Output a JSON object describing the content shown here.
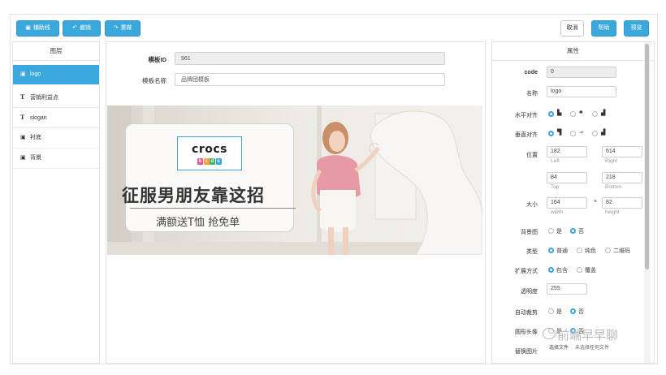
{
  "toolbar": {
    "guides_label": "辅助线",
    "undo_label": "撤销",
    "redo_label": "重做",
    "cancel_label": "取消",
    "help_label": "帮助",
    "preview_label": "预览"
  },
  "layers": {
    "header": "图层",
    "items": [
      {
        "icon": "image-icon",
        "label": "logo",
        "active": true
      },
      {
        "icon": "text-icon",
        "label": "营销利益点"
      },
      {
        "icon": "text-icon",
        "label": "slogan"
      },
      {
        "icon": "image-icon",
        "label": "衬底"
      },
      {
        "icon": "image-icon",
        "label": "背景"
      }
    ]
  },
  "template": {
    "id_label": "模板ID",
    "id_value": "961",
    "name_label": "模板名称",
    "name_value": "品牌团模板"
  },
  "banner": {
    "logo_text": "crocs",
    "logo_sub": [
      "k",
      "i",
      "d",
      "s"
    ],
    "slogan": "征服男朋友靠这招",
    "benefit": "满额送T恤 抢免单"
  },
  "properties": {
    "header": "属性",
    "code_label": "code",
    "code_value": "0",
    "name_label": "名称",
    "name_value": "logo",
    "halign_label": "水平对齐",
    "valign_label": "垂直对齐",
    "position_label": "位置",
    "left_value": "182",
    "left_hint": "Left",
    "right_value": "614",
    "right_hint": "Right",
    "top_value": "84",
    "top_hint": "Top",
    "bottom_value": "218",
    "bottom_hint": "Bottom",
    "size_label": "大小",
    "width_value": "164",
    "width_hint": "width",
    "times": "×",
    "height_value": "82",
    "height_hint": "height",
    "bgimage_label": "背景图",
    "yes": "是",
    "no": "否",
    "type_label": "类型",
    "type_normal": "普通",
    "type_solid": "纯色",
    "type_qr": "二维码",
    "expand_label": "扩展方式",
    "expand_contain": "包含",
    "expand_cover": "覆盖",
    "opacity_label": "透明度",
    "opacity_value": "255",
    "autocrop_label": "自动裁剪",
    "round_label": "圆形头像",
    "replace_label": "替换图片",
    "choose_file": "选择文件",
    "no_file": "未选择任何文件"
  },
  "watermark": "前端早早聊",
  "colors": {
    "accent": "#3aa8dc",
    "panel_bg": "#ffffff",
    "readonly_bg": "#eeeeee"
  }
}
